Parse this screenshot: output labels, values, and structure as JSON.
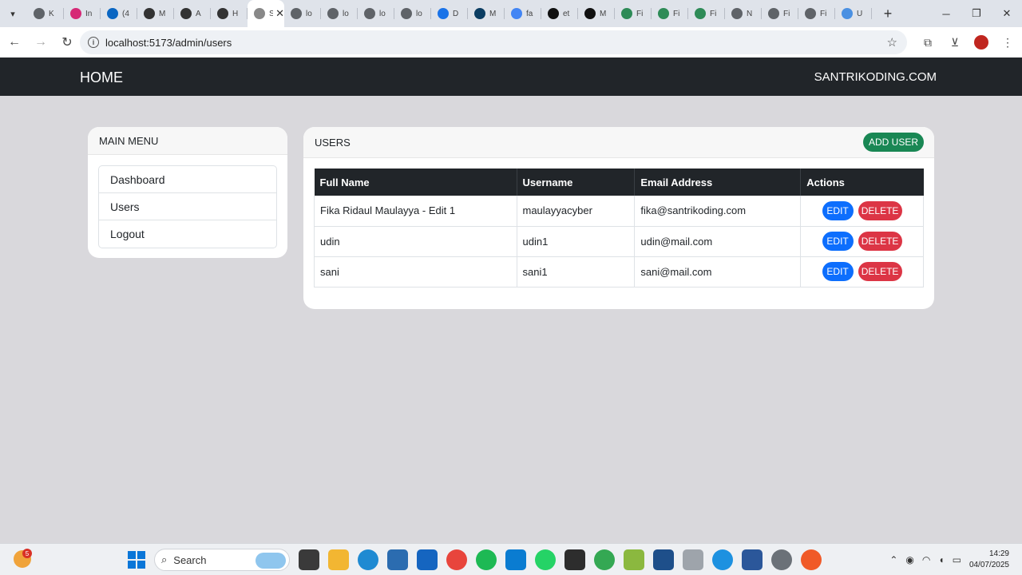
{
  "browser": {
    "tabs": [
      {
        "title": "K",
        "icon": "globe-icon",
        "color": "#5f6368"
      },
      {
        "title": "In",
        "icon": "instagram-icon",
        "color": "#d62976"
      },
      {
        "title": "(4",
        "icon": "linkedin-icon",
        "color": "#0a66c2"
      },
      {
        "title": "M",
        "icon": "github-copilot-icon",
        "color": "#333333"
      },
      {
        "title": "A",
        "icon": "github-copilot-icon",
        "color": "#333333"
      },
      {
        "title": "H",
        "icon": "github-copilot-icon",
        "color": "#333333"
      },
      {
        "title": "Sa",
        "icon": "app-icon",
        "color": "#888888",
        "active": true
      },
      {
        "title": "lo",
        "icon": "globe-icon",
        "color": "#5f6368"
      },
      {
        "title": "lo",
        "icon": "globe-icon",
        "color": "#5f6368"
      },
      {
        "title": "lo",
        "icon": "globe-icon",
        "color": "#5f6368"
      },
      {
        "title": "lo",
        "icon": "globe-icon",
        "color": "#5f6368"
      },
      {
        "title": "D",
        "icon": "download-icon",
        "color": "#1a73e8"
      },
      {
        "title": "M",
        "icon": "medium-icon",
        "color": "#0b3d62"
      },
      {
        "title": "fa",
        "icon": "google-icon",
        "color": "#4285f4"
      },
      {
        "title": "et",
        "icon": "github-icon",
        "color": "#111111"
      },
      {
        "title": "M",
        "icon": "threads-icon",
        "color": "#111111"
      },
      {
        "title": "Fi",
        "icon": "vue-icon",
        "color": "#2e8b57"
      },
      {
        "title": "Fi",
        "icon": "vue-icon",
        "color": "#2e8b57"
      },
      {
        "title": "Fi",
        "icon": "vue-icon",
        "color": "#2e8b57"
      },
      {
        "title": "N",
        "icon": "globe-icon",
        "color": "#5f6368"
      },
      {
        "title": "Fi",
        "icon": "globe-icon",
        "color": "#5f6368"
      },
      {
        "title": "Fi",
        "icon": "globe-icon",
        "color": "#5f6368"
      },
      {
        "title": "U",
        "icon": "diamond-icon",
        "color": "#4a90e2"
      }
    ],
    "url": "localhost:5173/admin/users"
  },
  "navbar": {
    "brand": "HOME",
    "right_link": "SANTRIKODING.COM"
  },
  "sidebar": {
    "title": "MAIN MENU",
    "items": [
      "Dashboard",
      "Users",
      "Logout"
    ]
  },
  "users_panel": {
    "title": "USERS",
    "add_button": "ADD USER",
    "columns": [
      "Full Name",
      "Username",
      "Email Address",
      "Actions"
    ],
    "rows": [
      {
        "full_name": "Fika Ridaul Maulayya - Edit 1",
        "username": "maulayyacyber",
        "email": "fika@santrikoding.com"
      },
      {
        "full_name": "udin",
        "username": "udin1",
        "email": "udin@mail.com"
      },
      {
        "full_name": "sani",
        "username": "sani1",
        "email": "sani@mail.com"
      }
    ],
    "edit_label": "EDIT",
    "delete_label": "DELETE"
  },
  "taskbar": {
    "weather_badge": "5",
    "search_label": "Search",
    "time": "14:29",
    "date": "04/07/2025"
  },
  "colors": {
    "navbar_bg": "#212529",
    "add_user": "#198754",
    "edit": "#0d6efd",
    "delete": "#dc3545"
  }
}
